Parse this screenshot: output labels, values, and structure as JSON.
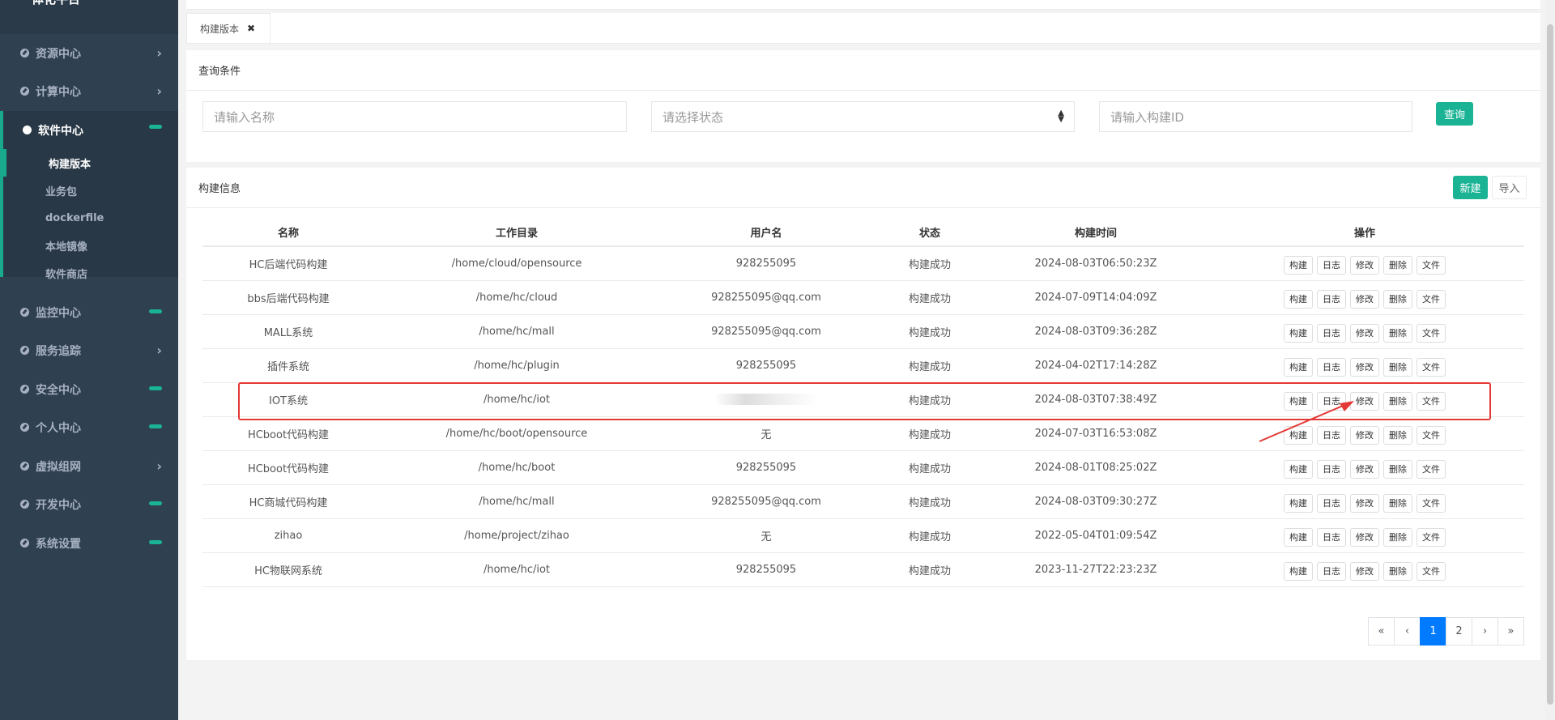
{
  "brand": "一体化平台",
  "sidebar": {
    "items": [
      {
        "label": "资源中心",
        "icon": "gear-icon",
        "indicator": "chevron"
      },
      {
        "label": "计算中心",
        "icon": "gear-icon",
        "indicator": "chevron"
      },
      {
        "label": "软件中心",
        "icon": "gear-icon",
        "indicator": "pill"
      },
      {
        "label": "监控中心",
        "icon": "gear-icon",
        "indicator": "pill"
      },
      {
        "label": "服务追踪",
        "icon": "gear-icon",
        "indicator": "chevron"
      },
      {
        "label": "安全中心",
        "icon": "gear-icon",
        "indicator": "pill"
      },
      {
        "label": "个人中心",
        "icon": "gear-icon",
        "indicator": "pill"
      },
      {
        "label": "虚拟组网",
        "icon": "gear-icon",
        "indicator": "chevron"
      },
      {
        "label": "开发中心",
        "icon": "gear-icon",
        "indicator": "pill"
      },
      {
        "label": "系统设置",
        "icon": "gear-icon",
        "indicator": "pill"
      }
    ],
    "submenu": [
      "构建版本",
      "业务包",
      "dockerfile",
      "本地镜像",
      "软件商店"
    ],
    "chevron": "›"
  },
  "tab": {
    "label": "构建版本",
    "close": "✖"
  },
  "query": {
    "title": "查询条件",
    "name_placeholder": "请输入名称",
    "status_placeholder": "请选择状态",
    "id_placeholder": "请输入构建ID",
    "search_label": "查询"
  },
  "info": {
    "title": "构建信息",
    "new_label": "新建",
    "import_label": "导入",
    "headers": [
      "名称",
      "工作目录",
      "用户名",
      "状态",
      "构建时间",
      "操作"
    ],
    "ops": [
      "构建",
      "日志",
      "修改",
      "删除",
      "文件"
    ],
    "rows": [
      {
        "name": "HC后端代码构建",
        "dir": "/home/cloud/opensource",
        "user": "928255095",
        "status": "构建成功",
        "time": "2024-08-03T06:50:23Z"
      },
      {
        "name": "bbs后端代码构建",
        "dir": "/home/hc/cloud",
        "user": "928255095@qq.com",
        "status": "构建成功",
        "time": "2024-07-09T14:04:09Z"
      },
      {
        "name": "MALL系统",
        "dir": "/home/hc/mall",
        "user": "928255095@qq.com",
        "status": "构建成功",
        "time": "2024-08-03T09:36:28Z"
      },
      {
        "name": "插件系统",
        "dir": "/home/hc/plugin",
        "user": "928255095",
        "status": "构建成功",
        "time": "2024-04-02T17:14:28Z"
      },
      {
        "name": "IOT系统",
        "dir": "/home/hc/iot",
        "user": "",
        "status": "构建成功",
        "time": "2024-08-03T07:38:49Z"
      },
      {
        "name": "HCboot代码构建",
        "dir": "/home/hc/boot/opensource",
        "user": "无",
        "status": "构建成功",
        "time": "2024-07-03T16:53:08Z"
      },
      {
        "name": "HCboot代码构建",
        "dir": "/home/hc/boot",
        "user": "928255095",
        "status": "构建成功",
        "time": "2024-08-01T08:25:02Z"
      },
      {
        "name": "HC商城代码构建",
        "dir": "/home/hc/mall",
        "user": "928255095@qq.com",
        "status": "构建成功",
        "time": "2024-08-03T09:30:27Z"
      },
      {
        "name": "zihao",
        "dir": "/home/project/zihao",
        "user": "无",
        "status": "构建成功",
        "time": "2022-05-04T01:09:54Z"
      },
      {
        "name": "HC物联网系统",
        "dir": "/home/hc/iot",
        "user": "928255095",
        "status": "构建成功",
        "time": "2023-11-27T22:23:23Z"
      }
    ]
  },
  "pager": {
    "first": "«",
    "prev": "‹",
    "pages": [
      "1",
      "2"
    ],
    "current": "1",
    "next": "›",
    "last": "»"
  },
  "colors": {
    "sidebar": "#2f4050",
    "accent": "#1ab394",
    "highlight": "#e53935",
    "page_active": "#007bff"
  }
}
